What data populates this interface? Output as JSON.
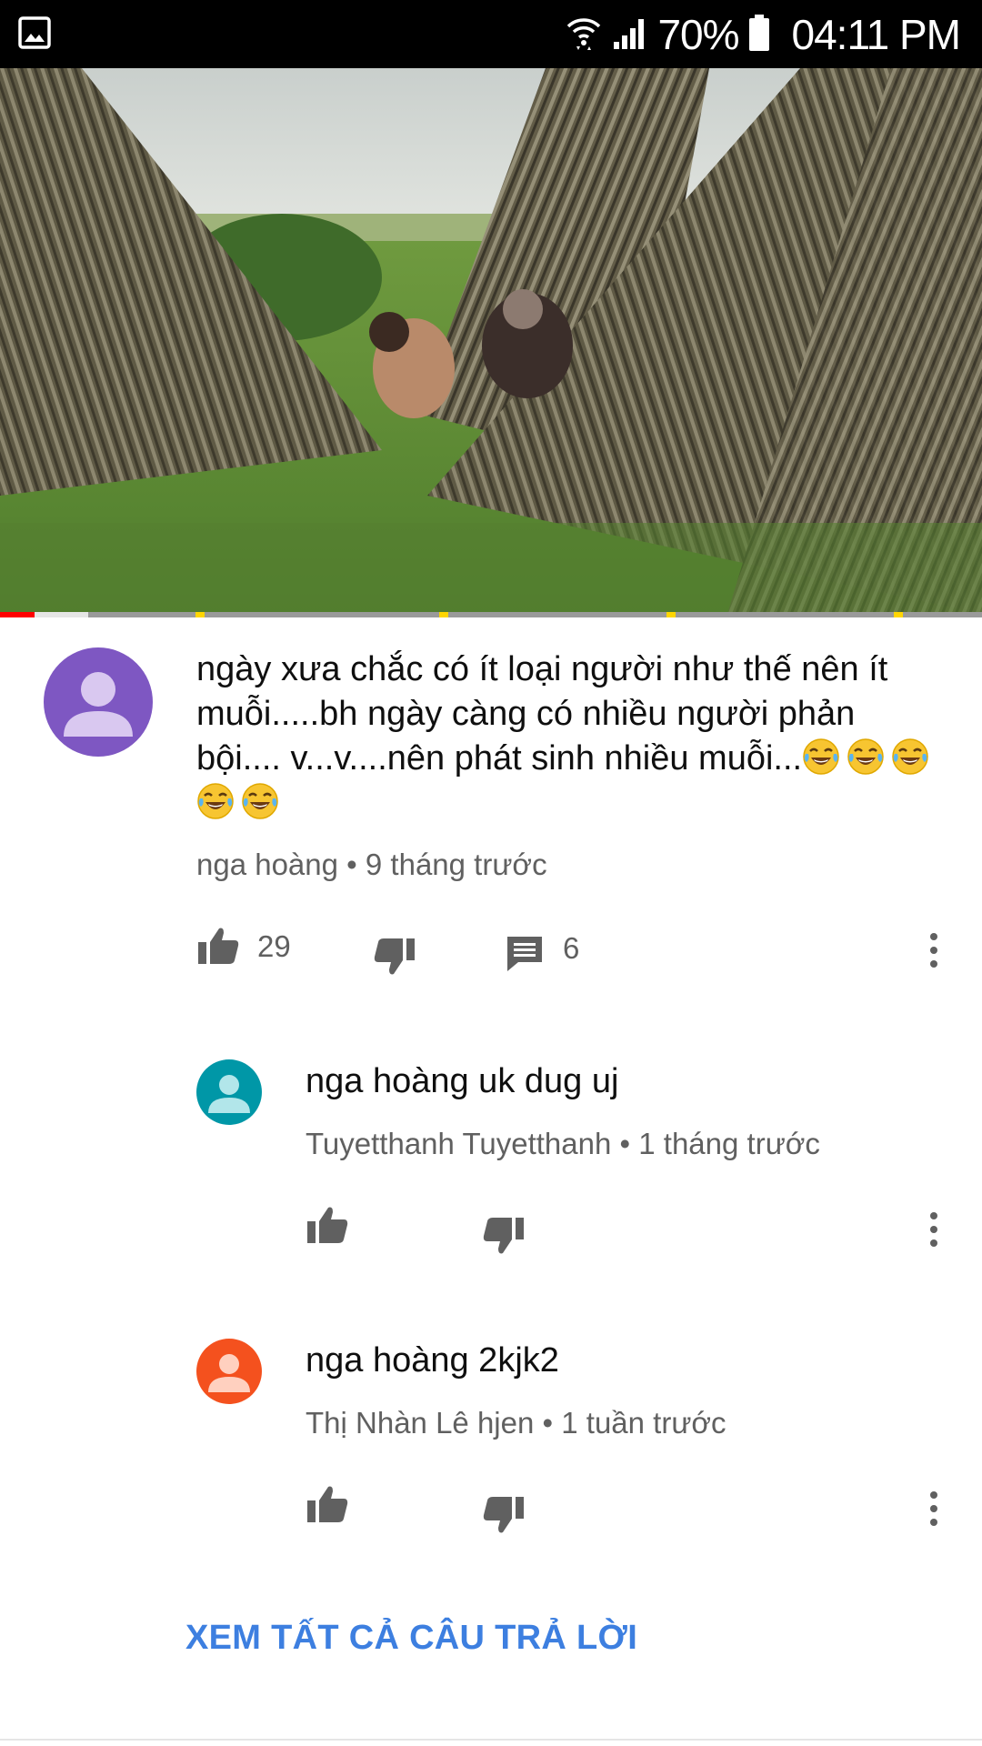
{
  "status_bar": {
    "battery": "70%",
    "time": "04:11 PM"
  },
  "video": {
    "progress_played": 0.035,
    "progress_buffered": 0.09
  },
  "comment": {
    "text": "ngày xưa chắc có ít  loại người như thế nên ít muỗi.....bh ngày càng có nhiều người phản bội.... v...v....nên phát sinh nhiều muỗi...",
    "emoji": "face-with-tears-of-joy",
    "author": "nga hoàng",
    "time": "9 tháng trước",
    "likes": "29",
    "replies_count": "6",
    "avatar_color": "#7e57c2"
  },
  "replies": [
    {
      "text": "nga hoàng uk dug uj",
      "author": "Tuyetthanh Tuyetthanh",
      "time": "1 tháng trước",
      "avatar_color": "#0097a7"
    },
    {
      "text": "nga hoàng 2kjk2",
      "author": "Thị Nhàn Lê hjen",
      "time": "1 tuần trước",
      "avatar_color": "#f4511e"
    }
  ],
  "separator": "•",
  "see_all_replies": "XEM TẤT CẢ CÂU TRẢ LỜI",
  "colors": {
    "link": "#3d7fe0",
    "meta_text": "#606060",
    "progress_red": "#ff0000"
  }
}
